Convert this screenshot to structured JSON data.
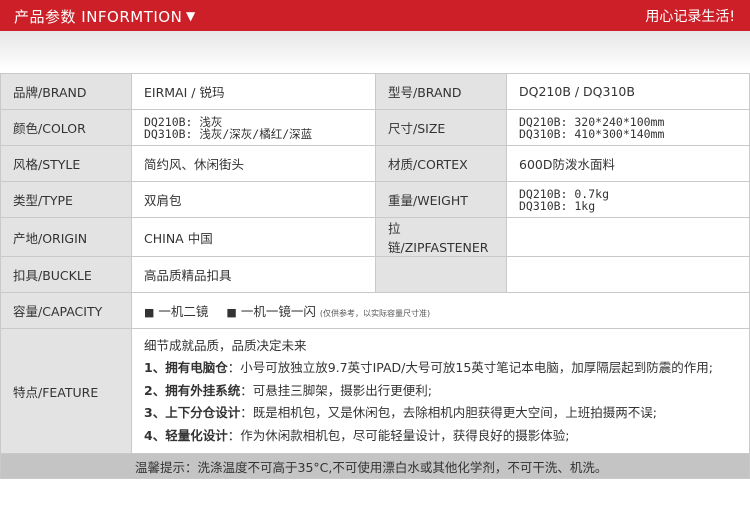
{
  "header": {
    "title": "产品参数 INFORMTION",
    "title_arrow": "▼",
    "slogan": "用心记录生活!"
  },
  "table": {
    "rows": [
      {
        "l1": "品牌/BRAND",
        "v1": [
          "EIRMAI / 锐玛"
        ],
        "l2": "型号/BRAND",
        "v2": [
          "DQ210B / DQ310B"
        ]
      },
      {
        "l1": "颜色/COLOR",
        "v1": [
          "DQ210B: 浅灰",
          "DQ310B: 浅灰/深灰/橘红/深蓝"
        ],
        "l2": "尺寸/SIZE",
        "v2": [
          "DQ210B: 320*240*100mm",
          "DQ310B: 410*300*140mm"
        ]
      },
      {
        "l1": "风格/STYLE",
        "v1": [
          "简约风、休闲街头"
        ],
        "l2": "材质/CORTEX",
        "v2": [
          "600D防泼水面料"
        ]
      },
      {
        "l1": "类型/TYPE",
        "v1": [
          "双肩包"
        ],
        "l2": "重量/WEIGHT",
        "v2": [
          "DQ210B: 0.7kg",
          "DQ310B: 1kg"
        ]
      },
      {
        "l1": "产地/ORIGIN",
        "v1": [
          "CHINA 中国"
        ],
        "l2": "拉链/ZIPFASTENER",
        "v2": []
      },
      {
        "l1": "扣具/BUCKLE",
        "v1": [
          "高品质精品扣具"
        ],
        "l2": "",
        "v2": []
      }
    ],
    "capacity": {
      "label": "容量/CAPACITY",
      "options": [
        "一机二镜",
        "一机一镜一闪"
      ],
      "note": "(仅供参考，以实际容量尺寸准)"
    },
    "feature": {
      "label": "特点/FEATURE",
      "intro": "细节成就品质，品质决定未来",
      "items": [
        {
          "bold": "1、拥有电脑仓",
          "text": "：小号可放独立放9.7英寸IPAD/大号可放15英寸笔记本电脑，加厚隔层起到防震的作用;"
        },
        {
          "bold": "2、拥有外挂系统",
          "text": "：可悬挂三脚架，摄影出行更便利;"
        },
        {
          "bold": "3、上下分仓设计",
          "text": "：既是相机包，又是休闲包，去除相机内胆获得更大空间，上班拍摄两不误;"
        },
        {
          "bold": "4、轻量化设计",
          "text": "：作为休闲款相机包，尽可能轻量设计，获得良好的摄影体验;"
        }
      ]
    },
    "notice": "温馨提示：洗涤温度不可高于35°C,不可使用漂白水或其他化学剂，不可干洗、机洗。"
  },
  "colors": {
    "header_red": "#cc1f27",
    "label_bg": "#e3e3e3",
    "notice_bg": "#c4c4c4",
    "border": "#c9c9c9"
  }
}
